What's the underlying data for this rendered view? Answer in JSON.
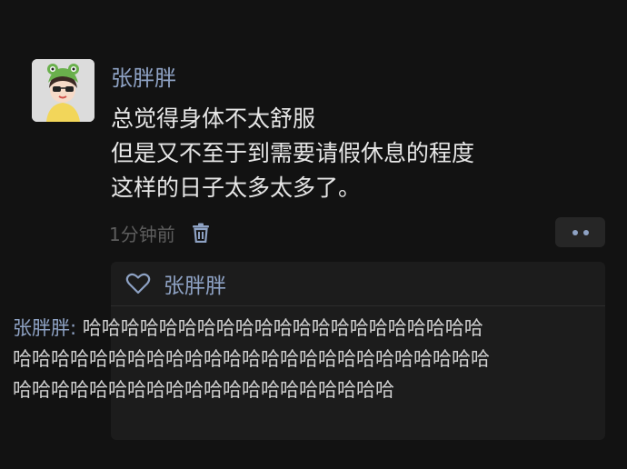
{
  "post": {
    "author": "张胖胖",
    "lines": [
      "总觉得身体不太舒服",
      "但是又不至于到需要请假休息的程度",
      "这样的日子太多太多了。"
    ],
    "time": "1分钟前"
  },
  "icons": {
    "avatar": "avatar-frog-hat-girl",
    "delete": "trash-icon",
    "more": "more-dots-icon",
    "like": "heart-outline-icon"
  },
  "likes": {
    "names": "张胖胖"
  },
  "comments": [
    {
      "author": "张胖胖:",
      "text": " 哈哈哈哈哈哈哈哈哈哈哈哈哈哈哈哈哈哈哈哈哈哈哈哈哈哈哈哈哈哈哈哈哈哈哈哈哈哈哈哈哈哈哈哈哈哈哈哈哈哈哈哈哈哈哈哈哈哈哈哈哈哈哈哈哈哈"
    }
  ],
  "colors": {
    "background": "#121212",
    "accent": "#8ea2c4",
    "text": "#e6e6e6",
    "muted": "#5d5d5d",
    "panel": "#1c1c1c"
  }
}
